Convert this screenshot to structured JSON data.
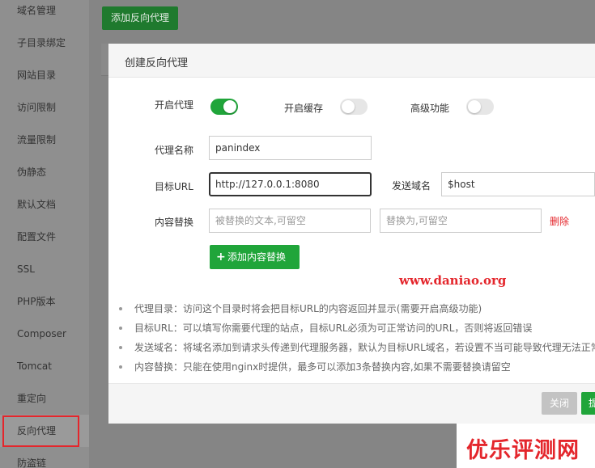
{
  "sidebar": {
    "items": [
      {
        "label": "域名管理"
      },
      {
        "label": "子目录绑定"
      },
      {
        "label": "网站目录"
      },
      {
        "label": "访问限制"
      },
      {
        "label": "流量限制"
      },
      {
        "label": "伪静态"
      },
      {
        "label": "默认文档"
      },
      {
        "label": "配置文件"
      },
      {
        "label": "SSL"
      },
      {
        "label": "PHP版本"
      },
      {
        "label": "Composer"
      },
      {
        "label": "Tomcat"
      },
      {
        "label": "重定向"
      },
      {
        "label": "反向代理"
      },
      {
        "label": "防盗链"
      }
    ],
    "active_index": 13
  },
  "toolbar": {
    "add_proxy_label": "添加反向代理"
  },
  "dialog": {
    "title": "创建反向代理",
    "enable_proxy": {
      "label": "开启代理",
      "on": true
    },
    "enable_cache": {
      "label": "开启缓存",
      "on": false
    },
    "advanced": {
      "label": "高级功能",
      "on": false
    },
    "proxy_name": {
      "label": "代理名称",
      "value": "panindex"
    },
    "target_url": {
      "label": "目标URL",
      "value": "http://127.0.0.1:8080"
    },
    "send_domain": {
      "label": "发送域名",
      "value": "$host"
    },
    "content_replace": {
      "label": "内容替换",
      "from_placeholder": "被替换的文本,可留空",
      "to_placeholder": "替换为,可留空",
      "delete_label": "删除"
    },
    "add_content_label": "添加内容替换",
    "tips": [
      "代理目录：访问这个目录时将会把目标URL的内容返回并显示(需要开启高级功能)",
      "目标URL：可以填写你需要代理的站点，目标URL必须为可正常访问的URL，否则将返回错误",
      "发送域名：将域名添加到请求头传递到代理服务器，默认为目标URL域名，若设置不当可能导致代理无法正常",
      "内容替换：只能在使用nginx时提供，最多可以添加3条替换内容,如果不需要替换请留空"
    ],
    "footer": {
      "close_label": "关闭",
      "submit_label": "提"
    }
  },
  "watermark": "www.daniao.org",
  "brand": "优乐评测网",
  "colors": {
    "accent": "#20a53a",
    "danger": "#e4262c"
  }
}
